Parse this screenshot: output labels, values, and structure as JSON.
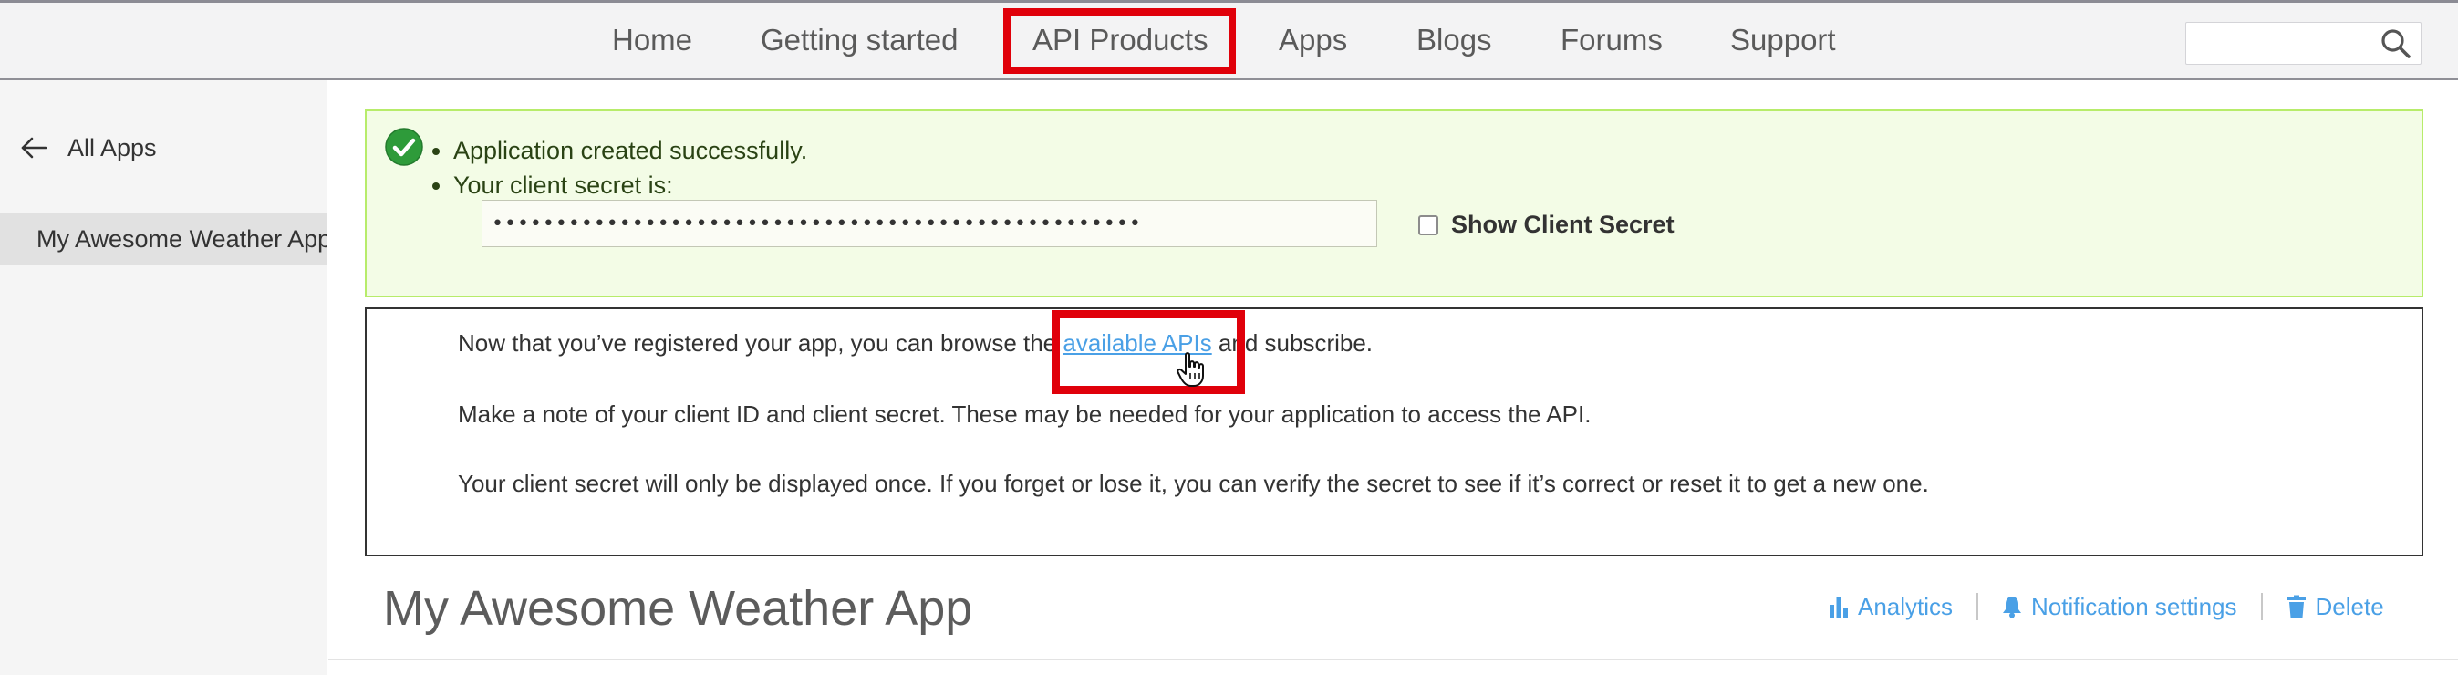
{
  "nav": {
    "items": [
      {
        "label": "Home"
      },
      {
        "label": "Getting started"
      },
      {
        "label": "API Products"
      },
      {
        "label": "Apps"
      },
      {
        "label": "Blogs"
      },
      {
        "label": "Forums"
      },
      {
        "label": "Support"
      }
    ],
    "highlighted_item": "API Products",
    "search": {
      "placeholder": "",
      "value": "",
      "icon": "search-icon"
    }
  },
  "sidebar": {
    "back_label": "All Apps",
    "back_icon": "arrow-left-icon",
    "apps": [
      {
        "label": "My Awesome Weather App",
        "selected": true
      }
    ]
  },
  "alert": {
    "icon": "check-circle-icon",
    "messages": [
      "Application created successfully.",
      "Your client secret is:"
    ],
    "secret_value": "•••••••••••••••••••••••••••••••••••••••••••••••••••",
    "show_secret_label": "Show Client Secret",
    "show_secret_checked": false
  },
  "info": {
    "p1_before": "Now that you’ve registered your app, you can browse the ",
    "p1_link": "available APIs",
    "p1_after": " and subscribe.",
    "p2": "Make a note of your client ID and client secret. These may be needed for your application to access the API.",
    "p3": "Your client secret will only be displayed once. If you forget or lose it, you can verify the secret to see if it’s correct or reset it to get a new one."
  },
  "app": {
    "title": "My Awesome Weather App",
    "actions": [
      {
        "label": "Analytics",
        "icon": "bar-chart-icon"
      },
      {
        "label": "Notification settings",
        "icon": "bell-icon"
      },
      {
        "label": "Delete",
        "icon": "trash-icon"
      }
    ]
  },
  "colors": {
    "accent_link": "#4aa0e6",
    "highlight_red": "#e0000a",
    "success_bg": "#f3fce6",
    "success_border": "#b7ec6a",
    "success_icon": "#2e9b3a"
  }
}
